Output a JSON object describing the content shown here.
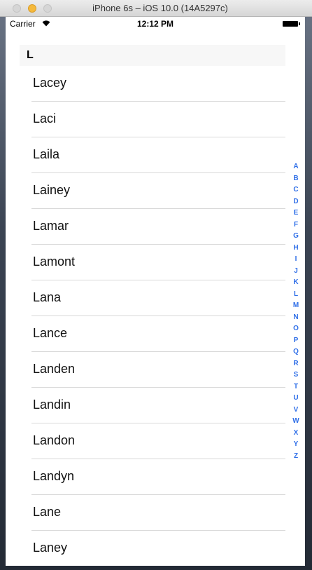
{
  "window": {
    "title": "iPhone 6s – iOS 10.0 (14A5297c)"
  },
  "status_bar": {
    "carrier": "Carrier",
    "time": "12:12 PM"
  },
  "section": {
    "title": "L"
  },
  "rows": [
    "Lacey",
    "Laci",
    "Laila",
    "Lainey",
    "Lamar",
    "Lamont",
    "Lana",
    "Lance",
    "Landen",
    "Landin",
    "Landon",
    "Landyn",
    "Lane",
    "Laney"
  ],
  "index": [
    "A",
    "B",
    "C",
    "D",
    "E",
    "F",
    "G",
    "H",
    "I",
    "J",
    "K",
    "L",
    "M",
    "N",
    "O",
    "P",
    "Q",
    "R",
    "S",
    "T",
    "U",
    "V",
    "W",
    "X",
    "Y",
    "Z"
  ],
  "colors": {
    "index_tint": "#2f6fe8",
    "minimize_light": "#f5b93b"
  }
}
